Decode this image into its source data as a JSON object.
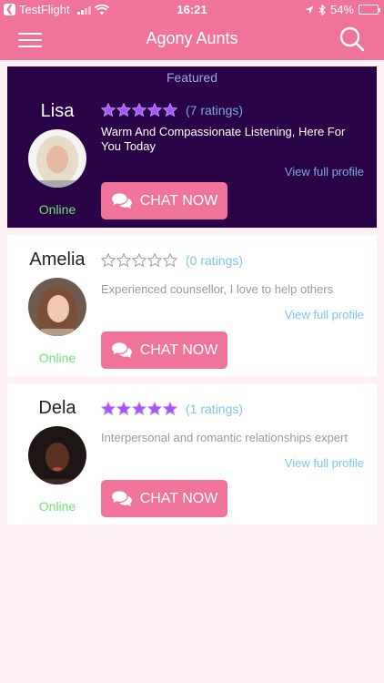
{
  "status_bar": {
    "carrier": "TestFlight",
    "time": "16:21",
    "battery": "54%",
    "battery_level": 0.54
  },
  "nav": {
    "title": "Agony Aunts",
    "menu_icon": "hamburger-menu-icon",
    "search_icon": "search-icon"
  },
  "featured_label": "Featured",
  "colors": {
    "accent": "#f07399",
    "featured_bg": "#2a0346",
    "star_filled": "#a855f7",
    "online": "#6fe07a",
    "link": "#7fc3ea"
  },
  "aunts": [
    {
      "name": "Lisa",
      "featured": true,
      "rating": 5,
      "ratings_text": "(7 ratings)",
      "description": "Warm And Compassionate Listening, Here For You Today",
      "view_profile": "View full profile",
      "status": "Online",
      "chat_label": "CHAT NOW"
    },
    {
      "name": "Amelia",
      "featured": false,
      "rating": 0,
      "ratings_text": "(0 ratings)",
      "description": "Experienced counsellor, I love to help others",
      "view_profile": "View full profile",
      "status": "Online",
      "chat_label": "CHAT NOW"
    },
    {
      "name": "Dela",
      "featured": false,
      "rating": 5,
      "ratings_text": "(1 ratings)",
      "description": "Interpersonal and romantic relationships expert",
      "view_profile": "View full profile",
      "status": "Online",
      "chat_label": "CHAT NOW"
    }
  ]
}
